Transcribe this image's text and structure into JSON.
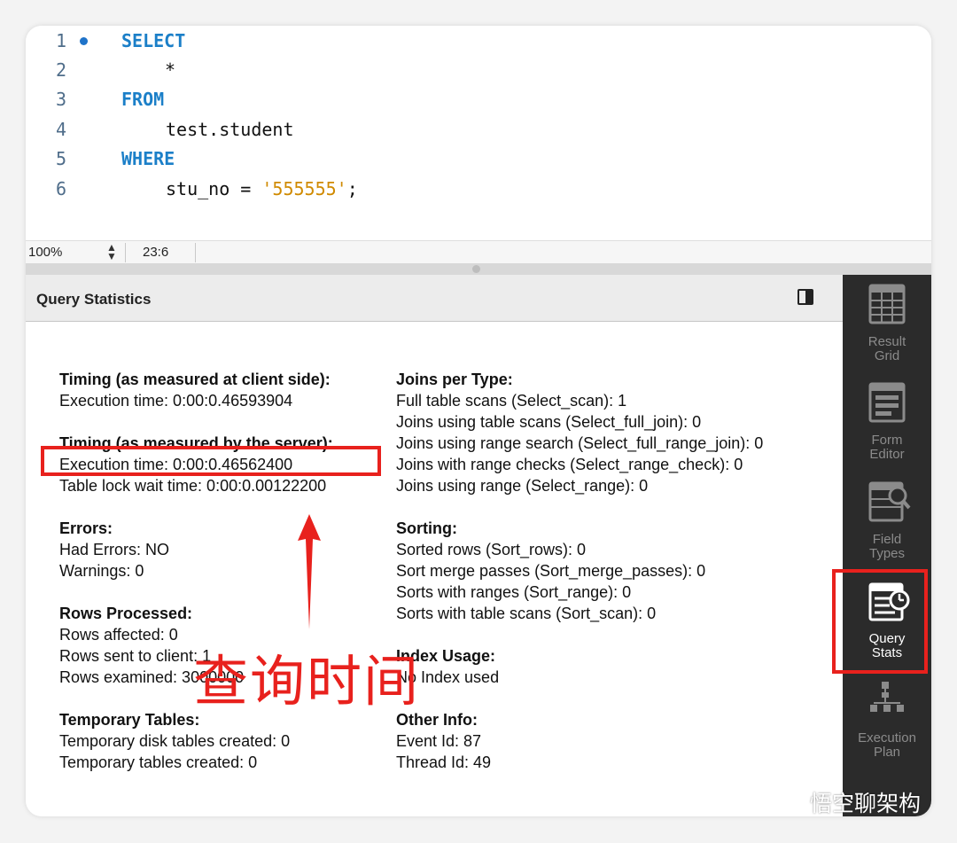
{
  "editor": {
    "lines": [
      {
        "n": "1",
        "text": "SELECT"
      },
      {
        "n": "2",
        "text": "*"
      },
      {
        "n": "3",
        "text": "FROM"
      },
      {
        "n": "4",
        "text": "test.student"
      },
      {
        "n": "5",
        "text": "WHERE"
      },
      {
        "n": "6",
        "text": "stu_no = ",
        "string": "'555555'",
        "end": ";"
      }
    ]
  },
  "statusbar": {
    "zoom": "100%",
    "cursor": "23:6"
  },
  "panel": {
    "title": "Query Statistics"
  },
  "stats": {
    "timing_client": {
      "heading": "Timing (as measured at client side):",
      "items": [
        "Execution time: 0:00:0.46593904"
      ]
    },
    "timing_server": {
      "heading": "Timing (as measured by the server):",
      "items": [
        "Execution time: 0:00:0.46562400",
        "Table lock wait time: 0:00:0.00122200"
      ]
    },
    "errors": {
      "heading": "Errors:",
      "items": [
        "Had Errors: NO",
        "Warnings: 0"
      ]
    },
    "rows": {
      "heading": "Rows Processed:",
      "items": [
        "Rows affected: 0",
        "Rows sent to client: 1",
        "Rows examined: 3000000"
      ]
    },
    "temp": {
      "heading": "Temporary Tables:",
      "items": [
        "Temporary disk tables created: 0",
        "Temporary tables created: 0"
      ]
    },
    "joins": {
      "heading": "Joins per Type:",
      "items": [
        "Full table scans (Select_scan): 1",
        "Joins using table scans (Select_full_join): 0",
        "Joins using range search (Select_full_range_join): 0",
        "Joins with range checks (Select_range_check): 0",
        "Joins using range (Select_range): 0"
      ]
    },
    "sorting": {
      "heading": "Sorting:",
      "items": [
        "Sorted rows (Sort_rows): 0",
        "Sort merge passes (Sort_merge_passes): 0",
        "Sorts with ranges (Sort_range): 0",
        "Sorts with table scans (Sort_scan): 0"
      ]
    },
    "index": {
      "heading": "Index Usage:",
      "items": [
        "No Index used"
      ]
    },
    "other": {
      "heading": "Other Info:",
      "items": [
        "Event Id: 87",
        "Thread Id: 49"
      ]
    }
  },
  "sidebar": {
    "items": [
      {
        "label1": "Result",
        "label2": "Grid",
        "icon": "grid-icon",
        "active": false
      },
      {
        "label1": "Form",
        "label2": "Editor",
        "icon": "form-icon",
        "active": false
      },
      {
        "label1": "Field",
        "label2": "Types",
        "icon": "field-types-icon",
        "active": false
      },
      {
        "label1": "Query",
        "label2": "Stats",
        "icon": "query-stats-icon",
        "active": true
      },
      {
        "label1": "Execution",
        "label2": "Plan",
        "icon": "execution-plan-icon",
        "active": false
      }
    ]
  },
  "annotation": {
    "callout": "查询时间",
    "color": "#e8211d"
  },
  "watermark": {
    "text": "悟空聊架构",
    "icon": "wechat-icon"
  },
  "colors": {
    "keyword": "#1b7fc8",
    "string": "#d08a00",
    "sidebar_bg": "#2b2b2b"
  }
}
